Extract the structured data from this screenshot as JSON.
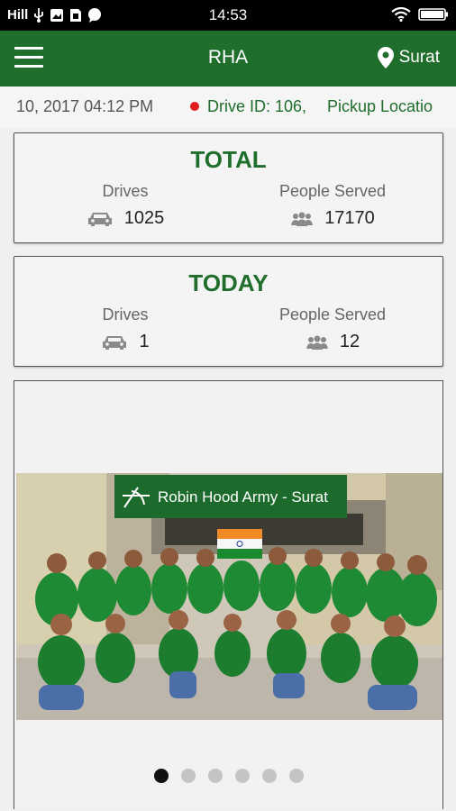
{
  "status_bar": {
    "time": "14:53",
    "carrier": "Hill",
    "left_icons": [
      "usb-icon",
      "photo-icon",
      "sim-icon",
      "chat-icon"
    ],
    "right_icons": [
      "wifi-icon",
      "battery-icon"
    ]
  },
  "app_bar": {
    "title": "RHA",
    "menu_icon": "hamburger-menu-icon",
    "location_icon": "location-pin-icon",
    "location_label": "Surat"
  },
  "ticker": {
    "date_text": "10, 2017 04:12 PM",
    "drive_text": "Drive ID: 106,",
    "pickup_text": "Pickup Locatio",
    "dot_color": "#e21d1d"
  },
  "total": {
    "heading": "TOTAL",
    "drives_label": "Drives",
    "drives_value": "1025",
    "people_label": "People Served",
    "people_value": "17170"
  },
  "today": {
    "heading": "TODAY",
    "drives_label": "Drives",
    "drives_value": "1",
    "people_label": "People Served",
    "people_value": "12"
  },
  "carousel": {
    "banner_text": "Robin Hood Army - Surat",
    "slide_count": 6,
    "active_index": 0
  },
  "colors": {
    "brand_green": "#1f6e2c",
    "status_bar": "#000000",
    "background": "#f0f0f0"
  }
}
